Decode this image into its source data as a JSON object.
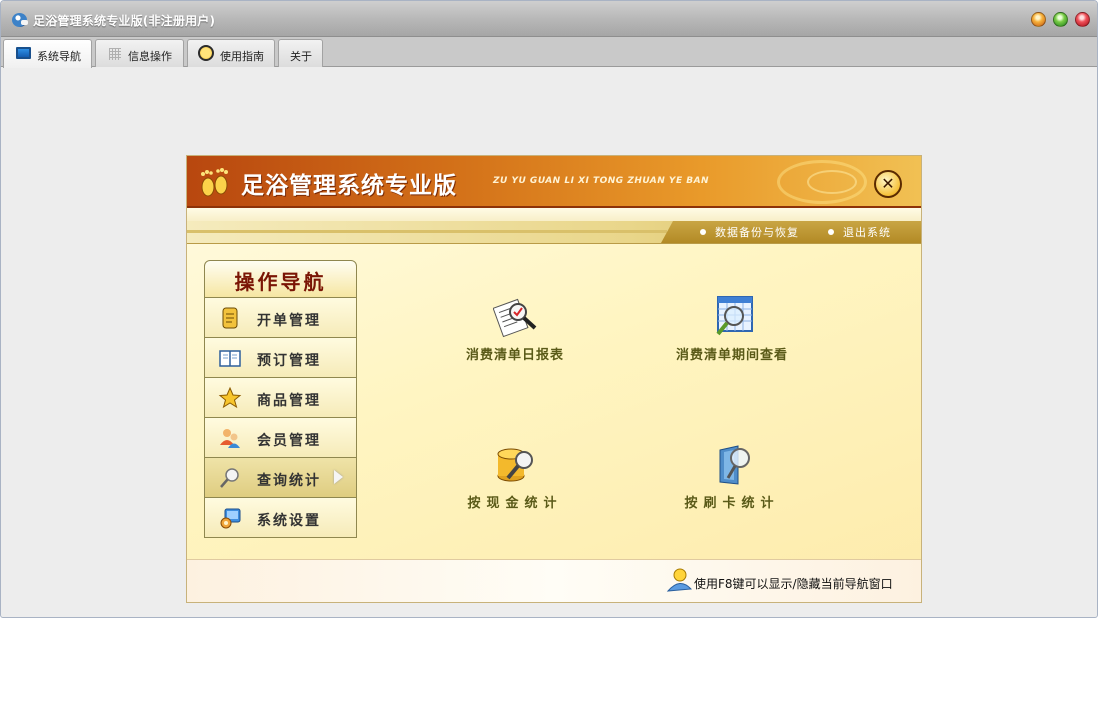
{
  "window": {
    "title": "足浴管理系统专业版(非注册用户)",
    "controls": {
      "minimize": "minimize-icon",
      "maximize": "maximize-icon",
      "close": "close-icon"
    }
  },
  "tabs": [
    {
      "label": "系统导航",
      "icon": "monitor-icon",
      "active": true
    },
    {
      "label": "信息操作",
      "icon": "grid-icon",
      "active": false
    },
    {
      "label": "使用指南",
      "icon": "clock-icon",
      "active": false
    },
    {
      "label": "关于",
      "icon": "",
      "active": false
    }
  ],
  "panel": {
    "title": "足浴管理系统专业版",
    "subtitle": "ZU YU GUAN LI XI TONG ZHUAN YE BAN",
    "links": {
      "backup": "数据备份与恢复",
      "exit": "退出系统"
    },
    "nav": {
      "heading": "操作导航",
      "items": [
        {
          "label": "开单管理",
          "icon": "document-icon"
        },
        {
          "label": "预订管理",
          "icon": "book-icon"
        },
        {
          "label": "商品管理",
          "icon": "star-icon"
        },
        {
          "label": "会员管理",
          "icon": "users-icon"
        },
        {
          "label": "查询统计",
          "icon": "magnifier-icon",
          "active": true
        },
        {
          "label": "系统设置",
          "icon": "settings-icon"
        }
      ]
    },
    "features": [
      {
        "label": "消费清单日报表",
        "icon": "report-search-icon"
      },
      {
        "label": "消费清单期间查看",
        "icon": "calendar-search-icon"
      },
      {
        "label": "按现金统计",
        "icon": "cash-search-icon"
      },
      {
        "label": "按刷卡统计",
        "icon": "card-search-icon"
      }
    ],
    "footer_tip": "使用F8键可以显示/隐藏当前导航窗口"
  },
  "colors": {
    "header_orange": "#d26f18",
    "nav_text": "#7a1505",
    "feature_text": "#5a5a18"
  }
}
